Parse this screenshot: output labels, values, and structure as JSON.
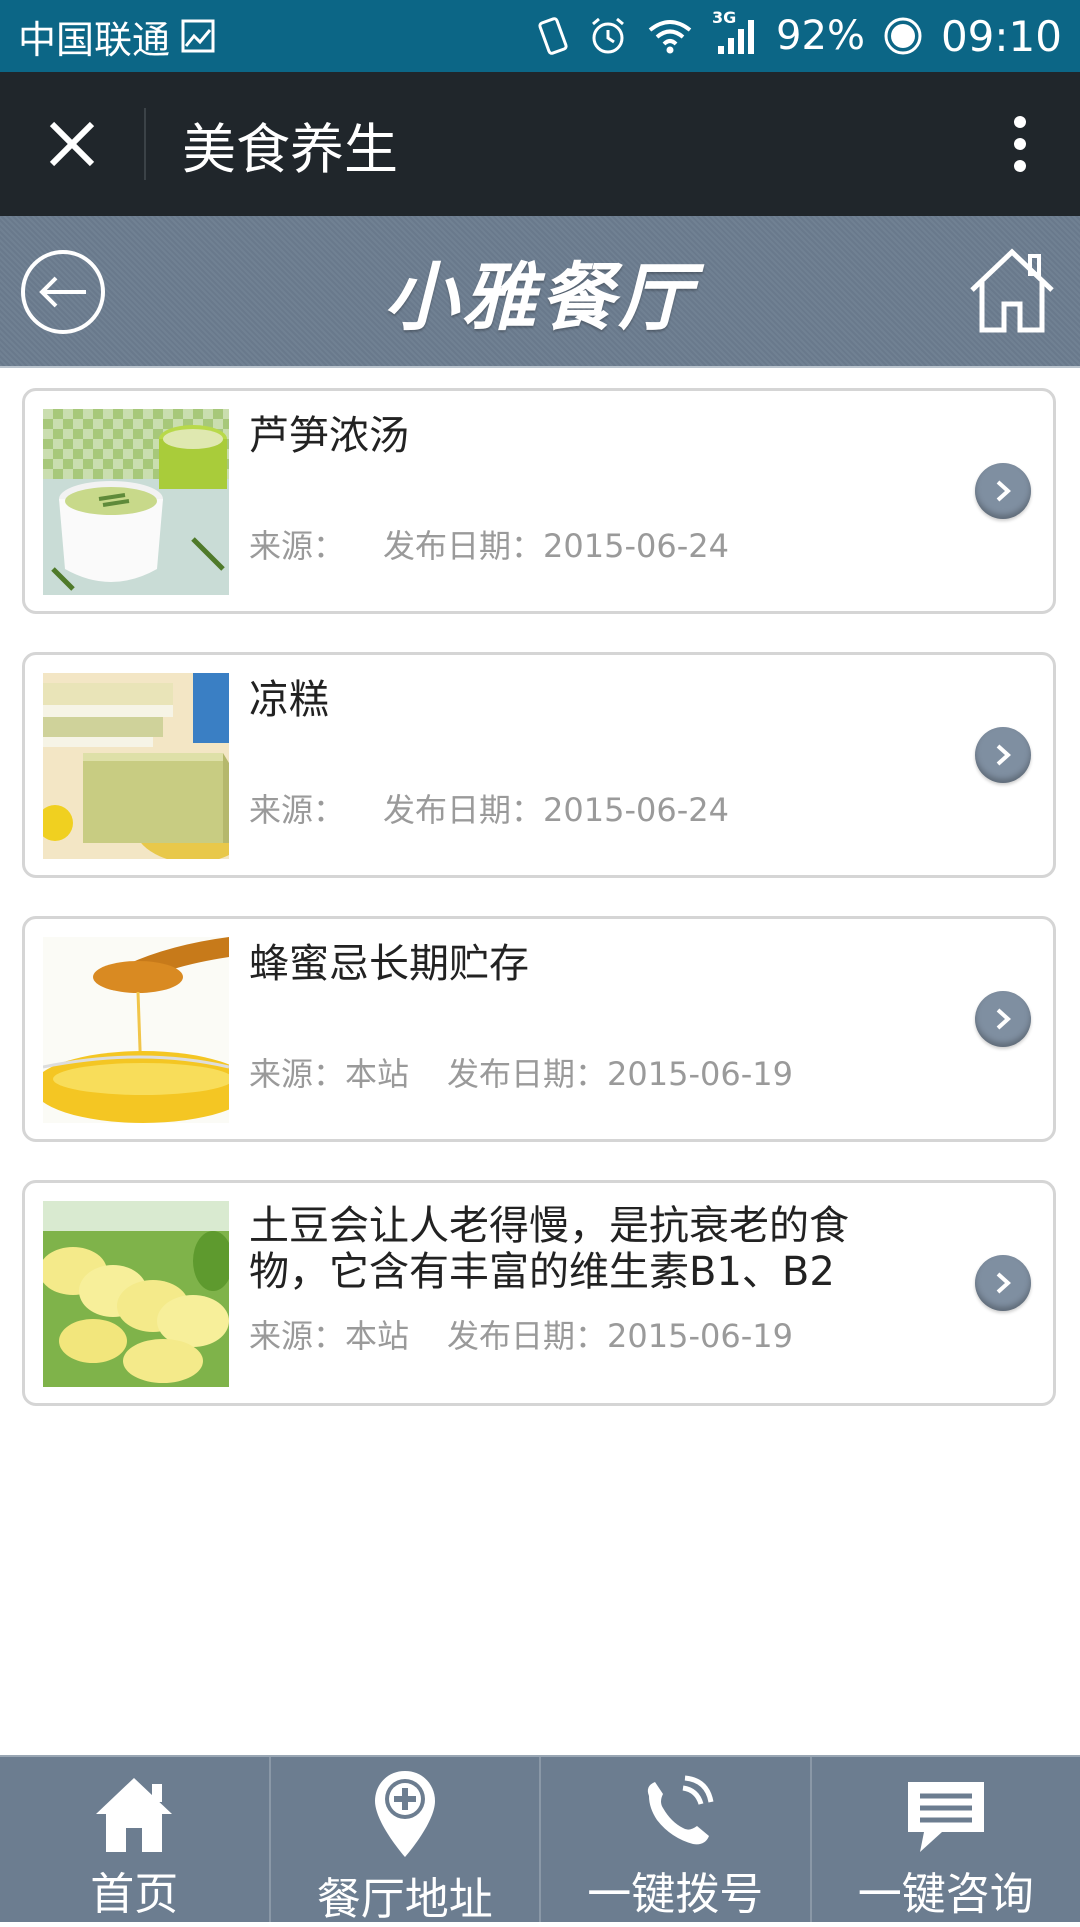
{
  "status_bar": {
    "carrier": "中国联通",
    "network": "3G",
    "battery": "92%",
    "time": "09:10"
  },
  "title_bar": {
    "title": "美食养生"
  },
  "site_header": {
    "logo_text": "小雅餐厅"
  },
  "articles": [
    {
      "title": "芦笋浓汤",
      "source_label": "来源：",
      "source": "",
      "date_label": "发布日期：",
      "date": "2015-06-24",
      "image": "asparagus-soup"
    },
    {
      "title": "凉糕",
      "source_label": "来源：",
      "source": "",
      "date_label": "发布日期：",
      "date": "2015-06-24",
      "image": "layered-cake"
    },
    {
      "title": "蜂蜜忌长期贮存",
      "source_label": "来源：",
      "source": "本站",
      "date_label": "发布日期：",
      "date": "2015-06-19",
      "image": "honey"
    },
    {
      "title": "土豆会让人老得慢，是抗衰老的食物，它含有丰富的维生素B1、B2",
      "source_label": "来源：",
      "source": "本站",
      "date_label": "发布日期：",
      "date": "2015-06-19",
      "image": "potato-slices"
    }
  ],
  "bottom_nav": [
    {
      "label": "首页",
      "icon": "home-icon"
    },
    {
      "label": "餐厅地址",
      "icon": "location-pin-icon"
    },
    {
      "label": "一键拨号",
      "icon": "phone-icon"
    },
    {
      "label": "一键咨询",
      "icon": "chat-icon"
    }
  ],
  "colors": {
    "status_bar": "#0c6686",
    "title_bar": "#20262b",
    "header": "#6c7d90"
  }
}
